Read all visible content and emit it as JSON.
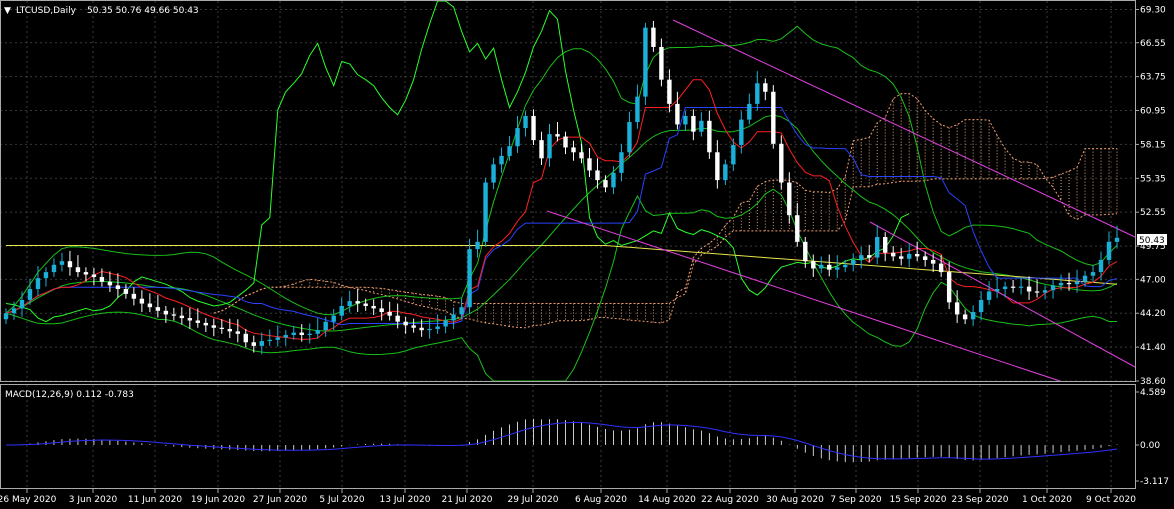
{
  "header": {
    "symbol": "LTCUSD,Daily",
    "ohlc": "50.35 50.76 49.66 50.43"
  },
  "macd": {
    "label": "MACD(12,26,9) 0.112 -0.783",
    "ticks": [
      4.589,
      0.0,
      -3.117
    ]
  },
  "colors": {
    "background": "#000000",
    "grid": "#3a3a3a",
    "bull": "#1bb0d8",
    "bear": "#ffffff",
    "bb": "#19c019",
    "chikou": "#2aff2a",
    "tenkan": "#ff2020",
    "kijun": "#2a42ff",
    "ma": "#e5e54d",
    "cloud": "#f0a070",
    "channel": "#e040e0"
  },
  "chart_data": {
    "type": "candlestick",
    "symbol": "LTCUSD",
    "timeframe": "Daily",
    "last_price": "50.43",
    "ylim": [
      38.6,
      70.0
    ],
    "price_ticks": [
      "69.30",
      "66.55",
      "63.75",
      "60.95",
      "58.15",
      "55.35",
      "52.55",
      "49.75",
      "47.00",
      "44.20",
      "41.40",
      "38.60"
    ],
    "date_labels": [
      "26 May 2020",
      "3 Jun 2020",
      "11 Jun 2020",
      "19 Jun 2020",
      "27 Jun 2020",
      "5 Jul 2020",
      "13 Jul 2020",
      "21 Jul 2020",
      "29 Jul 2020",
      "6 Aug 2020",
      "14 Aug 2020",
      "22 Aug 2020",
      "30 Aug 2020",
      "7 Sep 2020",
      "15 Sep 2020",
      "23 Sep 2020",
      "1 Oct 2020",
      "9 Oct 2020"
    ],
    "closes": [
      44.2,
      44.6,
      45.3,
      46.2,
      47.1,
      47.6,
      48.2,
      48.5,
      48.0,
      47.6,
      47.4,
      47.2,
      46.8,
      46.5,
      46.2,
      45.8,
      45.4,
      45.0,
      44.7,
      44.4,
      44.1,
      44.0,
      43.8,
      43.6,
      43.4,
      43.2,
      43.0,
      42.9,
      42.7,
      42.5,
      41.8,
      41.5,
      41.9,
      42.0,
      42.2,
      42.4,
      42.6,
      42.4,
      42.5,
      42.8,
      43.5,
      44.0,
      44.8,
      45.2,
      45.0,
      44.8,
      44.6,
      44.3,
      44.0,
      43.5,
      43.2,
      43.0,
      42.8,
      42.9,
      43.1,
      43.6,
      44.1,
      44.7,
      49.5,
      50.1,
      55.0,
      56.5,
      57.2,
      58.0,
      59.5,
      60.5,
      58.5,
      57.0,
      59.0,
      58.8,
      57.9,
      57.5,
      57.0,
      56.0,
      55.2,
      54.6,
      55.8,
      57.5,
      60.0,
      62.1,
      67.8,
      66.2,
      63.5,
      61.5,
      59.8,
      60.5,
      59.2,
      60.1,
      57.5,
      55.2,
      56.5,
      58.1,
      60.2,
      61.5,
      63.2,
      62.5,
      58.2,
      55.0,
      52.3,
      50.1,
      48.5,
      47.9,
      48.2,
      47.8,
      48.0,
      48.2,
      48.6,
      49.0,
      48.8,
      50.5,
      49.2,
      48.9,
      48.7,
      49.1,
      48.9,
      48.6,
      48.3,
      47.6,
      45.1,
      44.1,
      43.7,
      44.3,
      45.3,
      46.0,
      46.2,
      46.4,
      46.3,
      46.4,
      46.0,
      45.9,
      46.1,
      46.5,
      46.7,
      46.6,
      46.8,
      47.3,
      47.6,
      48.6,
      50.1,
      50.43
    ],
    "macd_ylim": [
      -3.117,
      4.589
    ]
  }
}
